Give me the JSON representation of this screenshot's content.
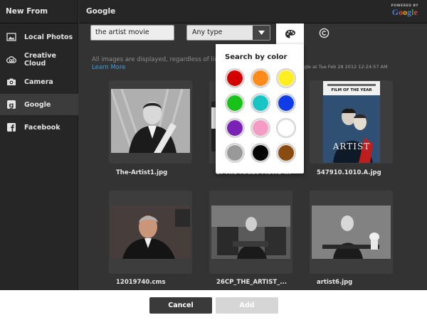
{
  "sidebar": {
    "title": "New From",
    "items": [
      {
        "label": "Local Photos",
        "icon": "image-icon"
      },
      {
        "label": "Creative Cloud",
        "icon": "creative-cloud-icon"
      },
      {
        "label": "Camera",
        "icon": "camera-icon"
      },
      {
        "label": "Google",
        "icon": "google-icon",
        "active": true
      },
      {
        "label": "Facebook",
        "icon": "facebook-icon"
      }
    ]
  },
  "header": {
    "title": "Google",
    "powered_by": "POWERED BY",
    "brand": "Google"
  },
  "toolbar": {
    "search_value": "the artist movie",
    "type_select_value": "Any type"
  },
  "info": {
    "message": "All images are displayed, regardless of lic",
    "learn_more": "Learn More",
    "timestamp_partial": "gle at Tue Feb 28 2012 12:24:57 AM"
  },
  "color_search": {
    "title": "Search by color",
    "swatches": [
      "#d40000",
      "#ff8c1a",
      "#ffee22",
      "#19c219",
      "#19c4c4",
      "#0f3ce6",
      "#7a22b5",
      "#f59cc4",
      "#ffffff",
      "#999999",
      "#050505",
      "#8a4b10"
    ]
  },
  "images": [
    {
      "filename": "The-Artist1.jpg"
    },
    {
      "filename": "3.-The-Artist-Movie-..."
    },
    {
      "filename": "547910.1010.A.jpg",
      "poster_tagline": "FILM OF THE YEAR",
      "poster_title": "ARTIST"
    },
    {
      "filename": "12019740.cms"
    },
    {
      "filename": "26CP_THE_ARTIST_..."
    },
    {
      "filename": "artist6.jpg"
    }
  ],
  "footer": {
    "cancel_label": "Cancel",
    "add_label": "Add"
  }
}
